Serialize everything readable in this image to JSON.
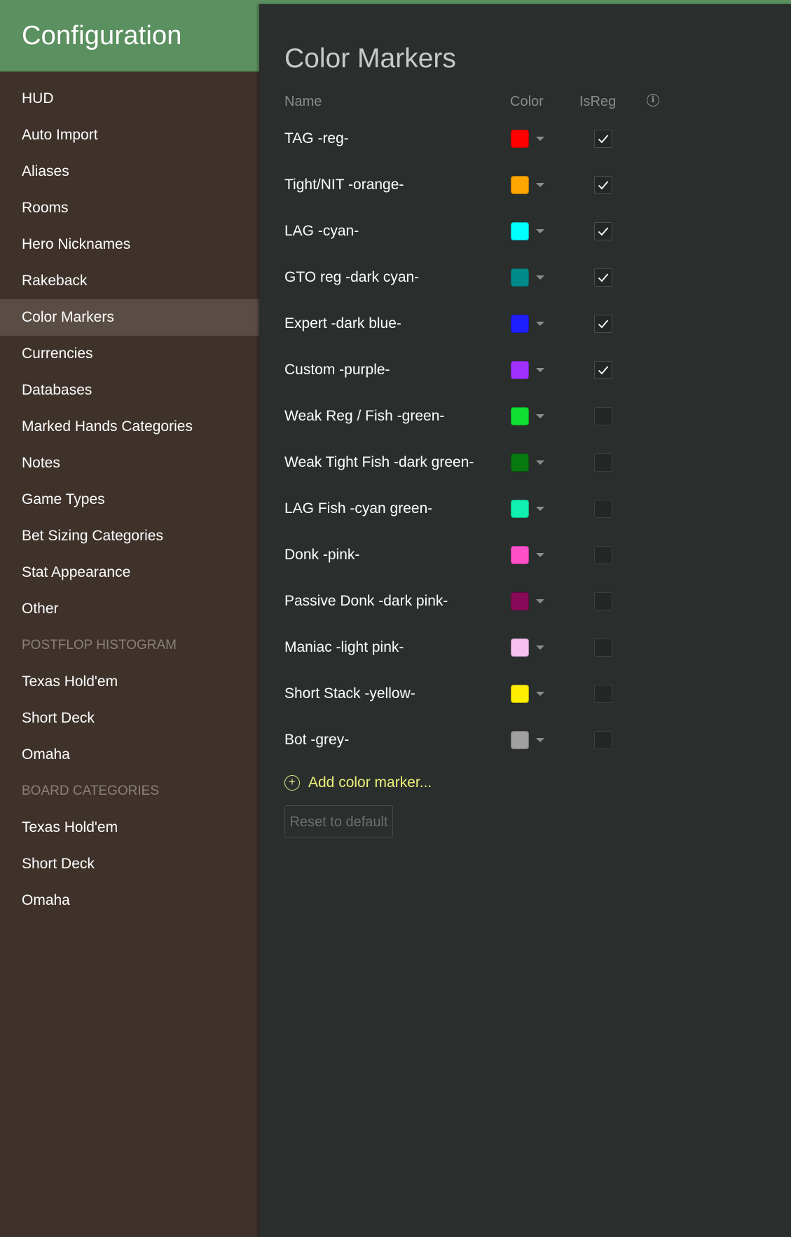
{
  "sidebar": {
    "title": "Configuration",
    "items": [
      {
        "label": "HUD",
        "type": "item"
      },
      {
        "label": "Auto Import",
        "type": "item"
      },
      {
        "label": "Aliases",
        "type": "item"
      },
      {
        "label": "Rooms",
        "type": "item"
      },
      {
        "label": "Hero Nicknames",
        "type": "item"
      },
      {
        "label": "Rakeback",
        "type": "item"
      },
      {
        "label": "Color Markers",
        "type": "item",
        "active": true
      },
      {
        "label": "Currencies",
        "type": "item"
      },
      {
        "label": "Databases",
        "type": "item"
      },
      {
        "label": "Marked Hands Categories",
        "type": "item"
      },
      {
        "label": "Notes",
        "type": "item"
      },
      {
        "label": "Game Types",
        "type": "item"
      },
      {
        "label": "Bet Sizing Categories",
        "type": "item"
      },
      {
        "label": "Stat Appearance",
        "type": "item"
      },
      {
        "label": "Other",
        "type": "item"
      },
      {
        "label": "POSTFLOP HISTOGRAM",
        "type": "heading"
      },
      {
        "label": "Texas Hold'em",
        "type": "item"
      },
      {
        "label": "Short Deck",
        "type": "item"
      },
      {
        "label": "Omaha",
        "type": "item"
      },
      {
        "label": "BOARD CATEGORIES",
        "type": "heading"
      },
      {
        "label": "Texas Hold'em",
        "type": "item"
      },
      {
        "label": "Short Deck",
        "type": "item"
      },
      {
        "label": "Omaha",
        "type": "item"
      }
    ]
  },
  "main": {
    "title": "Color Markers",
    "columns": {
      "name": "Name",
      "color": "Color",
      "isreg": "IsReg"
    },
    "info_icon": "info-icon",
    "markers": [
      {
        "name": "TAG -reg-",
        "color": "#ff0000",
        "isreg": true
      },
      {
        "name": "Tight/NIT -orange-",
        "color": "#ffa500",
        "isreg": true
      },
      {
        "name": "LAG -cyan-",
        "color": "#00ffff",
        "isreg": true
      },
      {
        "name": "GTO reg -dark cyan-",
        "color": "#008b8b",
        "isreg": true
      },
      {
        "name": "Expert -dark blue-",
        "color": "#1f1fff",
        "isreg": true
      },
      {
        "name": "Custom -purple-",
        "color": "#a030ff",
        "isreg": true
      },
      {
        "name": "Weak Reg / Fish -green-",
        "color": "#10e030",
        "isreg": false
      },
      {
        "name": "Weak Tight Fish -dark green-",
        "color": "#087a10",
        "isreg": false
      },
      {
        "name": "LAG Fish -cyan green-",
        "color": "#10f0b0",
        "isreg": false
      },
      {
        "name": "Donk -pink-",
        "color": "#ff50c8",
        "isreg": false
      },
      {
        "name": "Passive Donk -dark pink-",
        "color": "#8a0a5a",
        "isreg": false
      },
      {
        "name": "Maniac -light pink-",
        "color": "#f8c0f0",
        "isreg": false
      },
      {
        "name": "Short Stack -yellow-",
        "color": "#ffee00",
        "isreg": false
      },
      {
        "name": "Bot -grey-",
        "color": "#a0a0a0",
        "isreg": false
      }
    ],
    "add_label": "Add color marker...",
    "reset_label": "Reset to default"
  },
  "colors": {
    "header_green": "#5b9060",
    "sidebar_bg": "#3e322b",
    "sidebar_active": "#5a4d45",
    "main_bg": "#2a2e2c",
    "accent_yellow": "#eef27a"
  }
}
